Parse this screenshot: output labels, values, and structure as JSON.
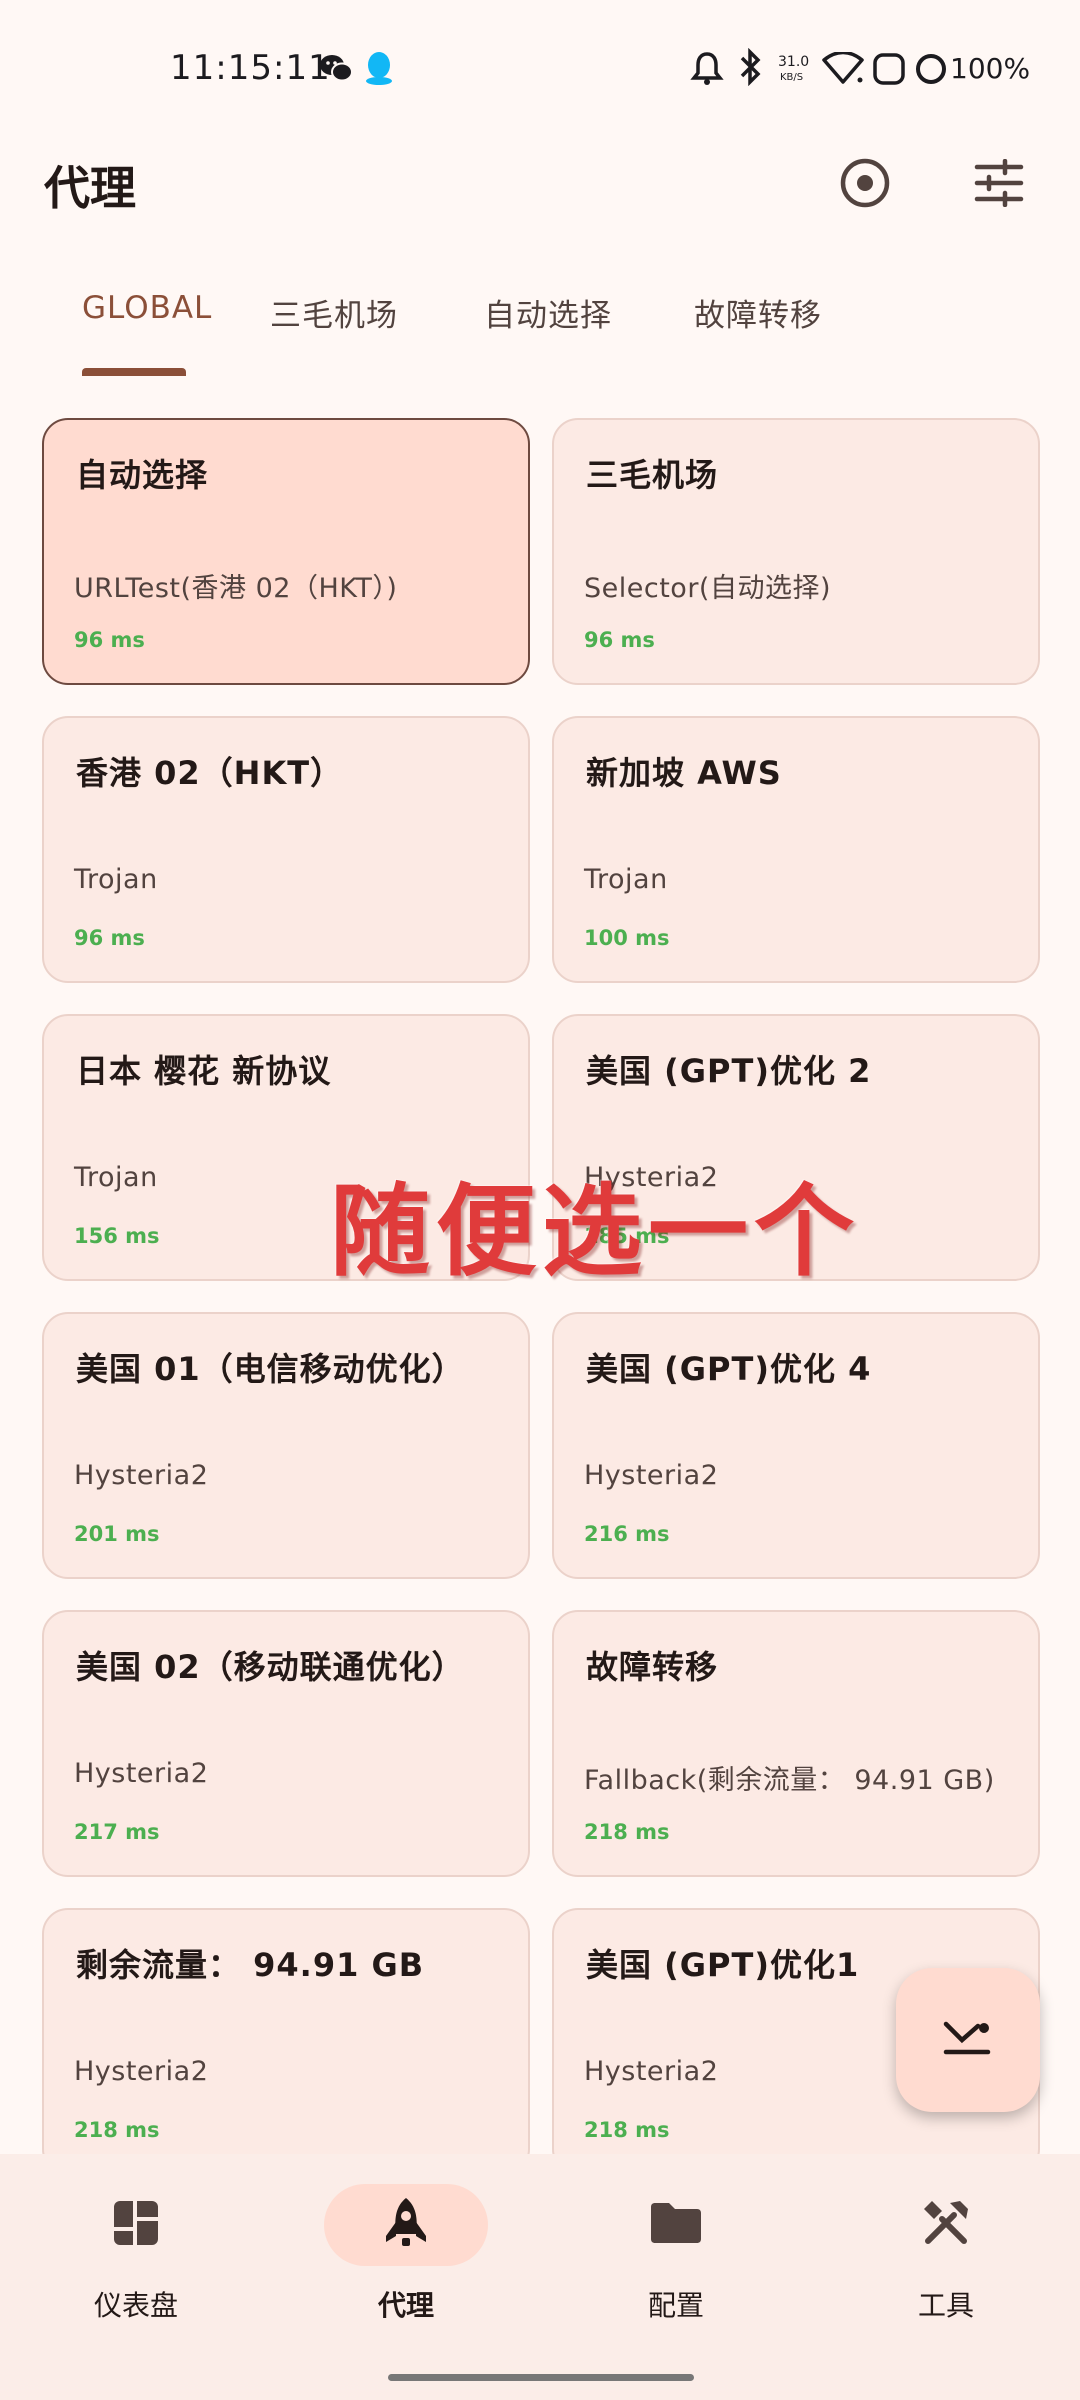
{
  "status_bar": {
    "time": "11:15:11",
    "net_speed_value": "31.0",
    "net_speed_unit": "KB/S",
    "battery": "100%",
    "icons": [
      "wechat-icon",
      "qq-icon",
      "bell-icon",
      "bluetooth-icon",
      "wifi-icon",
      "screen-icon",
      "circle-icon"
    ]
  },
  "header": {
    "title": "代理",
    "icons": [
      "target-icon",
      "tune-icon"
    ]
  },
  "tabs": [
    {
      "label": "GLOBAL",
      "active": true
    },
    {
      "label": "三毛机场",
      "active": false
    },
    {
      "label": "自动选择",
      "active": false
    },
    {
      "label": "故障转移",
      "active": false
    }
  ],
  "proxies": [
    {
      "name": "自动选择",
      "type": "URLTest(香港 02（HKT）)",
      "delay": "96 ms",
      "selected": true
    },
    {
      "name": "三毛机场",
      "type": "Selector(自动选择)",
      "delay": "96 ms",
      "selected": false
    },
    {
      "name": "香港 02（HKT）",
      "type": "Trojan",
      "delay": "96 ms",
      "selected": false
    },
    {
      "name": "新加坡 AWS",
      "type": "Trojan",
      "delay": "100 ms",
      "selected": false
    },
    {
      "name": "日本 樱花 新协议",
      "type": "Trojan",
      "delay": "156 ms",
      "selected": false
    },
    {
      "name": "美国 (GPT)优化 2",
      "type": "Hysteria2",
      "delay": "185 ms",
      "selected": false
    },
    {
      "name": "美国 01（电信移动优化）",
      "type": "Hysteria2",
      "delay": "201 ms",
      "selected": false
    },
    {
      "name": "美国 (GPT)优化 4",
      "type": "Hysteria2",
      "delay": "216 ms",
      "selected": false
    },
    {
      "name": "美国 02（移动联通优化）",
      "type": "Hysteria2",
      "delay": "217 ms",
      "selected": false
    },
    {
      "name": "故障转移",
      "type": "Fallback(剩余流量： 94.91 GB)",
      "delay": "218 ms",
      "selected": false
    },
    {
      "name": "剩余流量： 94.91 GB",
      "type": "Hysteria2",
      "delay": "218 ms",
      "selected": false
    },
    {
      "name": "美国 (GPT)优化1",
      "type": "Hysteria2",
      "delay": "218 ms",
      "selected": false
    }
  ],
  "overlay_caption": "随便选一个",
  "fab": {
    "icon": "collapse-icon"
  },
  "bottom_nav": [
    {
      "label": "仪表盘",
      "icon": "dashboard-icon",
      "active": false
    },
    {
      "label": "代理",
      "icon": "rocket-icon",
      "active": true
    },
    {
      "label": "配置",
      "icon": "folder-icon",
      "active": false
    },
    {
      "label": "工具",
      "icon": "tools-icon",
      "active": false
    }
  ],
  "colors": {
    "background": "#FFF8F5",
    "card": "#FCEAE4",
    "card_selected": "#FFDBD0",
    "accent": "#8B4F38",
    "delay_good": "#4CAF50",
    "overlay_text": "#E03B3B"
  }
}
